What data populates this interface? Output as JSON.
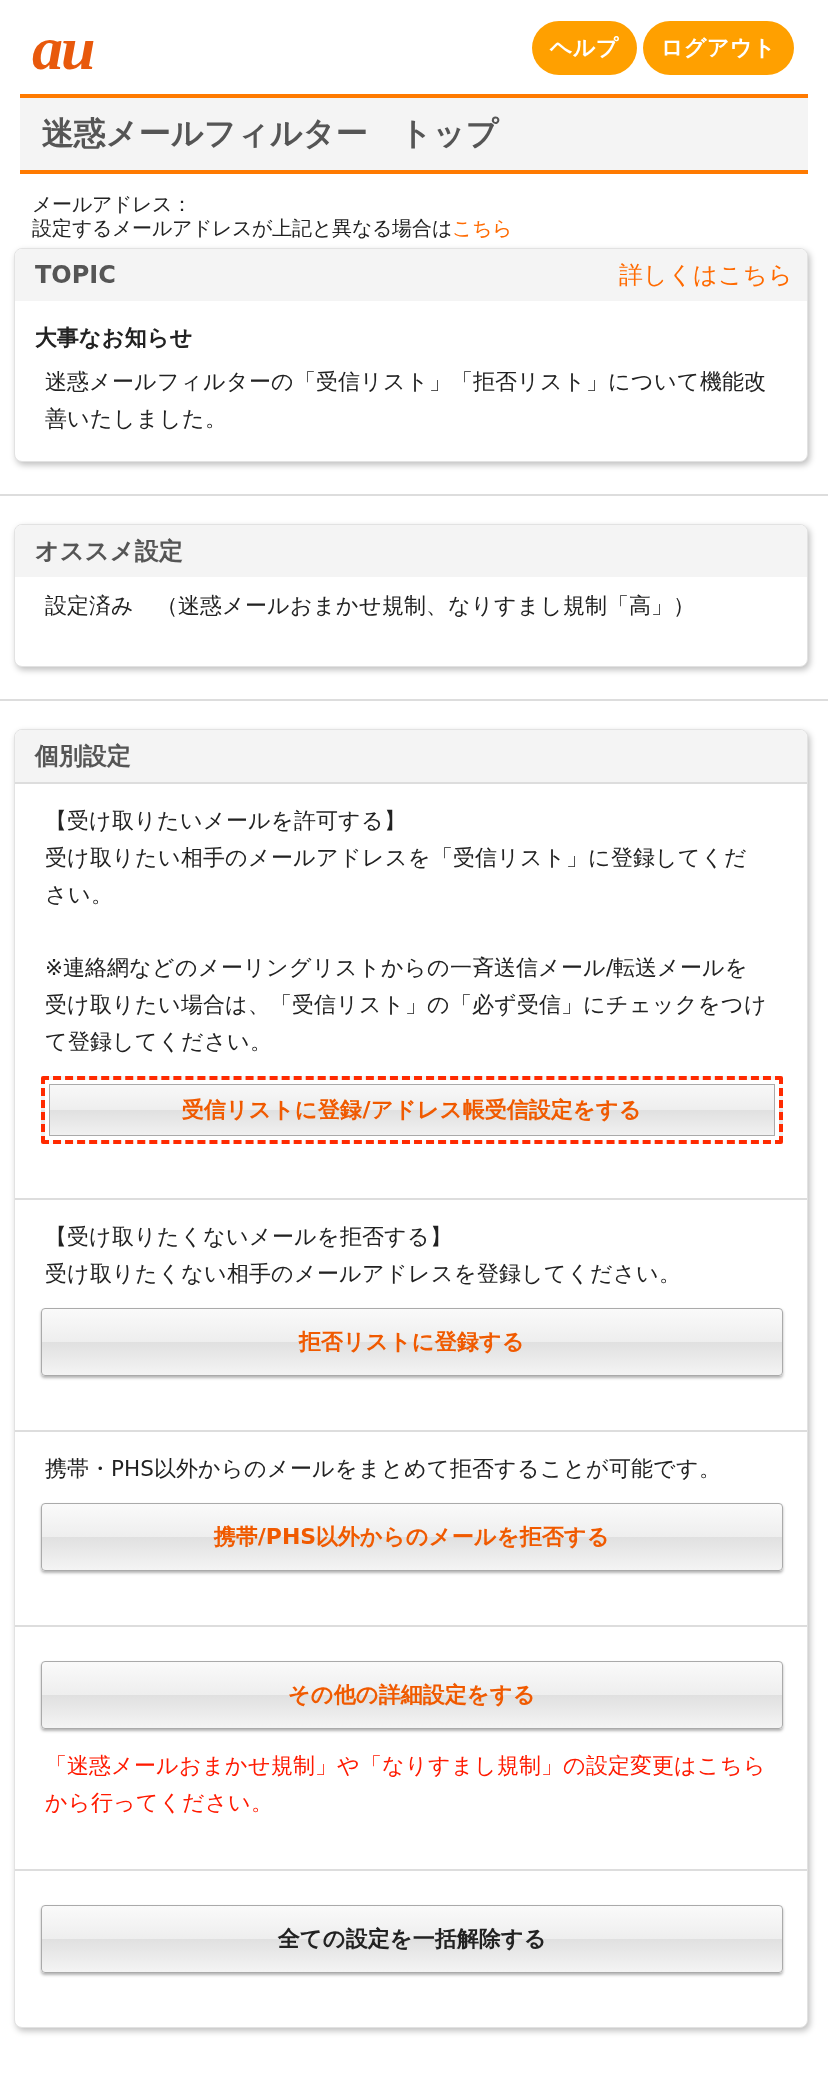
{
  "header": {
    "logo": "au",
    "buttons": [
      "ヘルプ",
      "ログアウト"
    ]
  },
  "page_title": "迷惑メールフィルター　トップ",
  "address": {
    "label": "メールアドレス：",
    "note": "設定するメールアドレスが上記と異なる場合は",
    "link": "こちら"
  },
  "topic": {
    "title": "TOPIC",
    "link": "詳しくはこちら",
    "heading": "大事なお知らせ",
    "body": "迷惑メールフィルターの「受信リスト」「拒否リスト」について機能改善いたしました。"
  },
  "recommended": {
    "title": "オススメ設定",
    "body": "設定済み　（迷惑メールおまかせ規制、なりすまし規制「高」）"
  },
  "individual": {
    "title": "個別設定",
    "sections": [
      {
        "lines": [
          "【受け取りたいメールを許可する】",
          "受け取りたい相手のメールアドレスを「受信リスト」に登録してください。",
          "※連絡網などのメーリングリストからの一斉送信メール/転送メールを受け取りたい場合は、「受信リスト」の「必ず受信」にチェックをつけて登録してください。"
        ],
        "button": {
          "label": "受信リストに登録/アドレス帳受信設定をする",
          "kind": "accent",
          "highlighted": true
        }
      },
      {
        "lines": [
          "【受け取りたくないメールを拒否する】",
          "受け取りたくない相手のメールアドレスを登録してください。"
        ],
        "button": {
          "label": "拒否リストに登録する",
          "kind": "accent",
          "highlighted": false
        }
      },
      {
        "lines": [
          "携帯・PHS以外からのメールをまとめて拒否することが可能です。"
        ],
        "button": {
          "label": "携帯/PHS以外からのメールを拒否する",
          "kind": "accent",
          "highlighted": false
        }
      },
      {
        "button": {
          "label": "その他の詳細設定をする",
          "kind": "accent",
          "highlighted": false
        },
        "note": "「迷惑メールおまかせ規制」や「なりすまし規制」の設定変更はこちらから行ってください。"
      },
      {
        "button": {
          "label": "全ての設定を一括解除する",
          "kind": "neutral",
          "highlighted": false
        }
      }
    ]
  }
}
